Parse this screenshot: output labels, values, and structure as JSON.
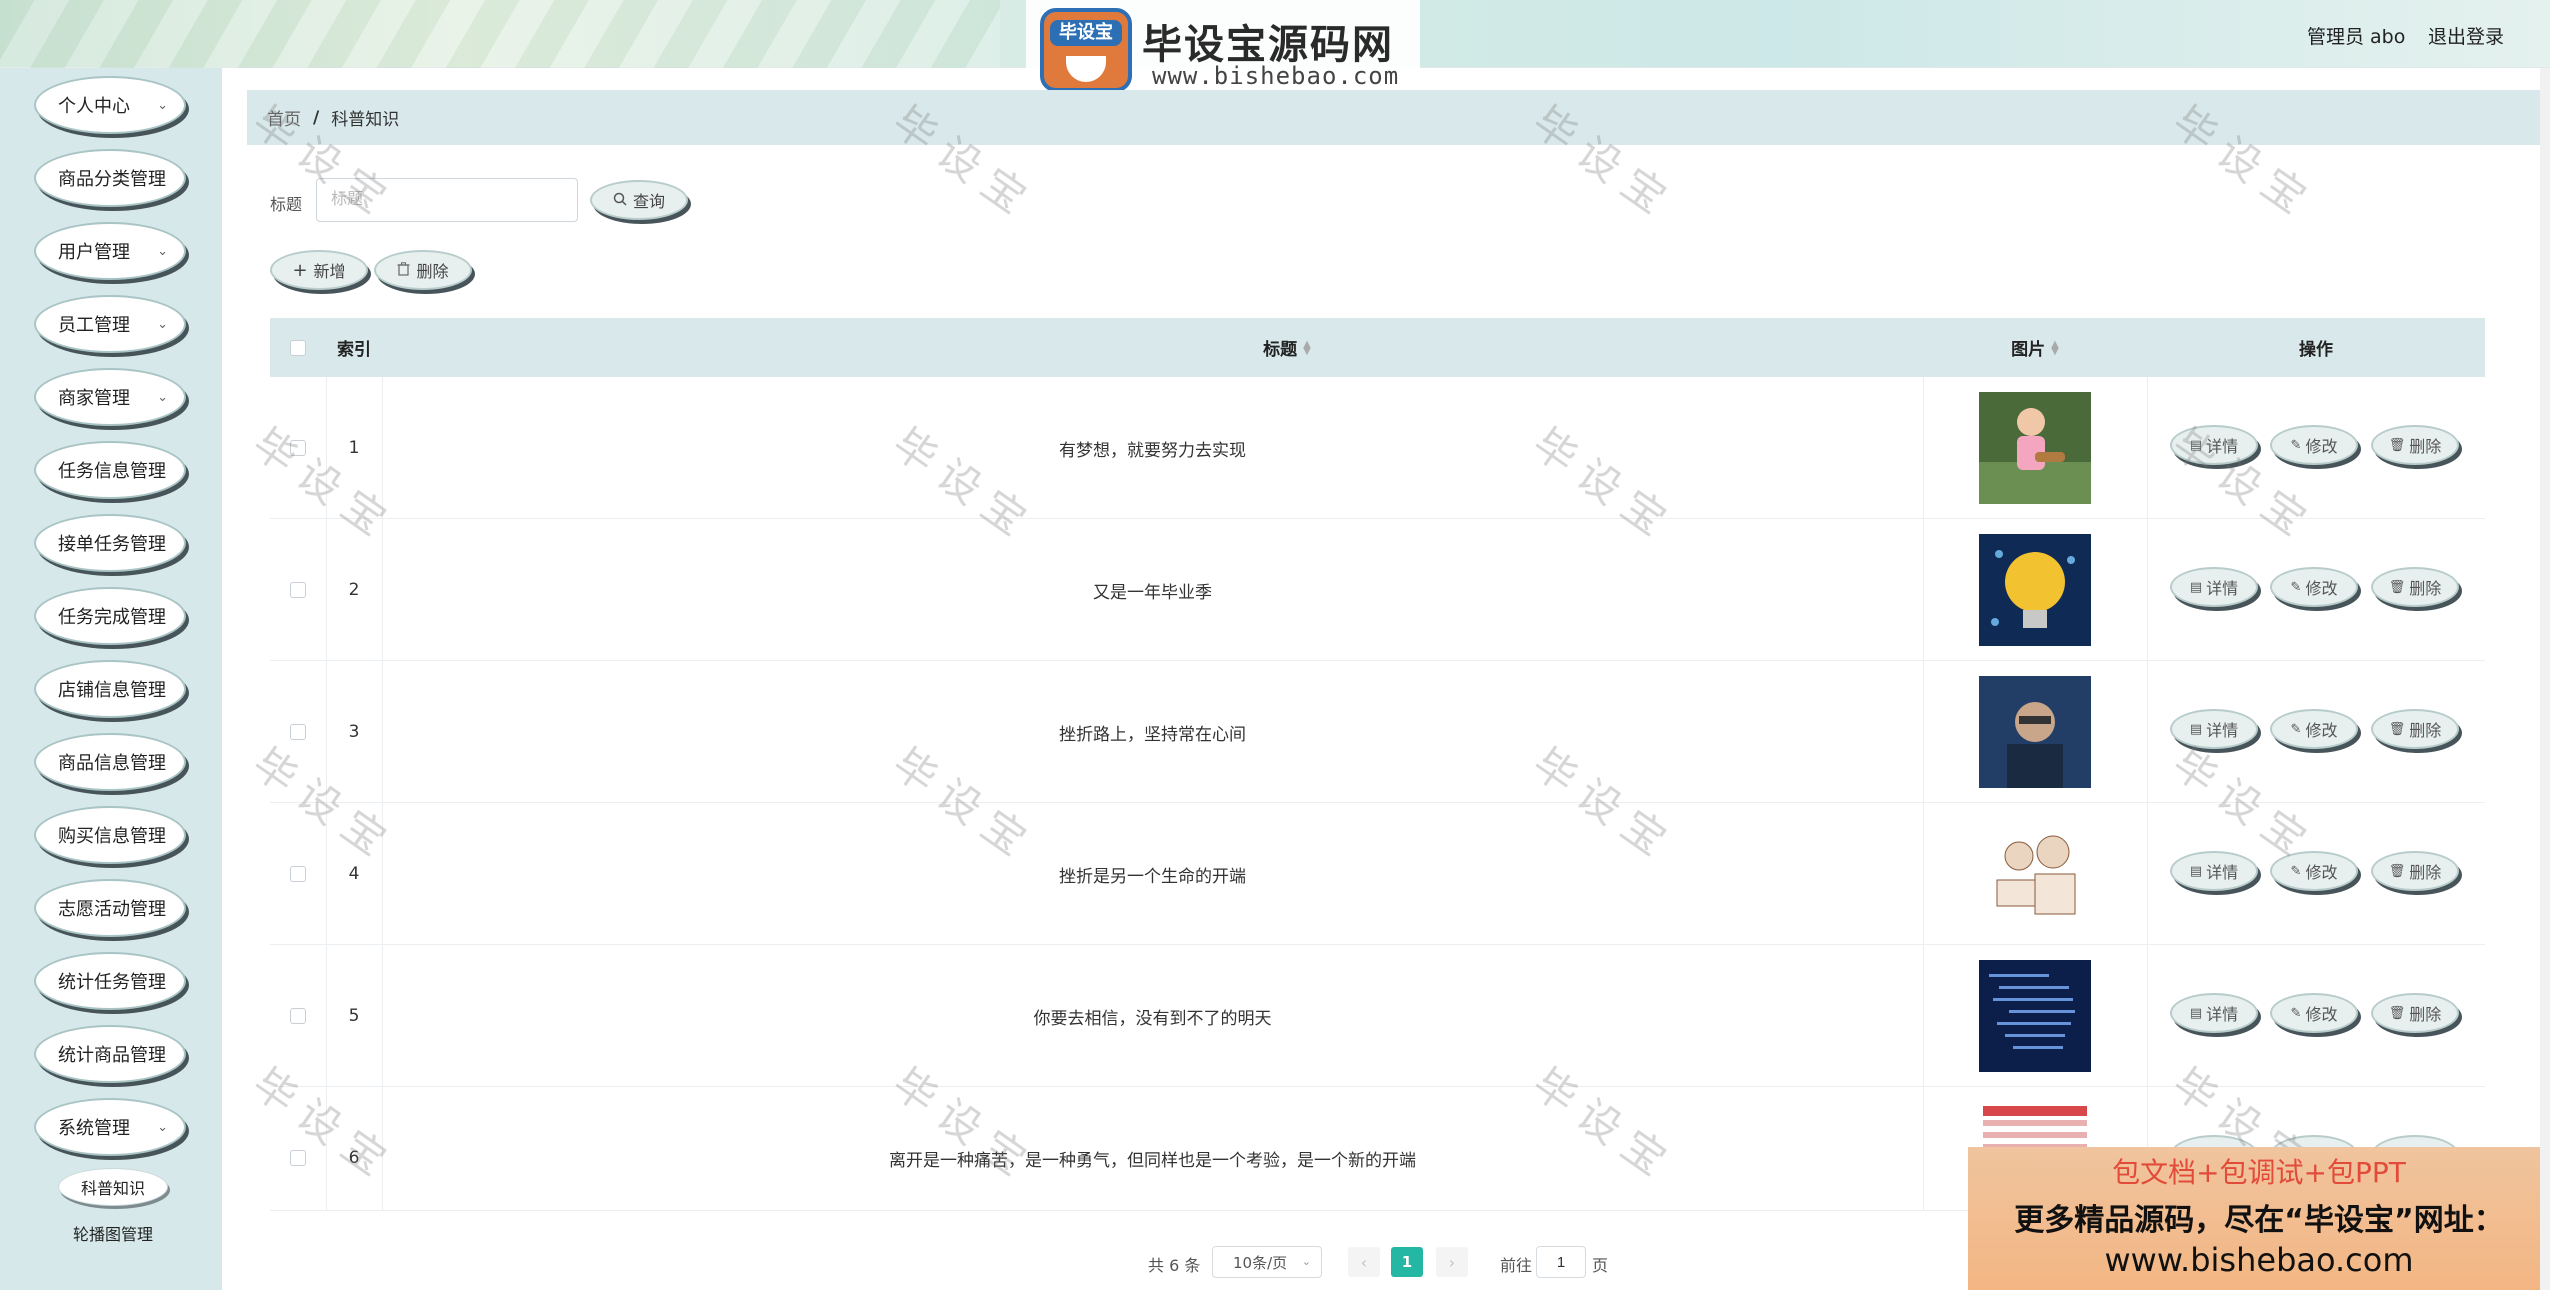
{
  "header": {
    "logo_badge": "毕设宝",
    "logo_title": "毕设宝源码网",
    "logo_url": "www.bishebao.com",
    "admin_label": "管理员 abo",
    "logout_label": "退出登录"
  },
  "sidebar": {
    "items": [
      {
        "label": "个人中心",
        "has_arrow": true
      },
      {
        "label": "商品分类管理",
        "has_arrow": false
      },
      {
        "label": "用户管理",
        "has_arrow": true
      },
      {
        "label": "员工管理",
        "has_arrow": true
      },
      {
        "label": "商家管理",
        "has_arrow": true
      },
      {
        "label": "任务信息管理",
        "has_arrow": false
      },
      {
        "label": "接单任务管理",
        "has_arrow": false
      },
      {
        "label": "任务完成管理",
        "has_arrow": false
      },
      {
        "label": "店铺信息管理",
        "has_arrow": false
      },
      {
        "label": "商品信息管理",
        "has_arrow": false
      },
      {
        "label": "购买信息管理",
        "has_arrow": false
      },
      {
        "label": "志愿活动管理",
        "has_arrow": false
      },
      {
        "label": "统计任务管理",
        "has_arrow": false
      },
      {
        "label": "统计商品管理",
        "has_arrow": false
      },
      {
        "label": "系统管理",
        "has_arrow": true
      }
    ],
    "sub_items": [
      "科普知识",
      "轮播图管理"
    ],
    "arrow_glyph": "⌄"
  },
  "breadcrumb": {
    "home": "首页",
    "separator": "/",
    "current": "科普知识"
  },
  "search": {
    "label": "标题",
    "placeholder": "标题",
    "value": "",
    "button": "查询"
  },
  "toolbar": {
    "add": "新增",
    "delete": "删除"
  },
  "table": {
    "columns": {
      "index": "索引",
      "title": "标题",
      "image": "图片",
      "actions": "操作"
    },
    "rows": [
      {
        "index": "1",
        "title": "有梦想，就要努力去实现"
      },
      {
        "index": "2",
        "title": "又是一年毕业季"
      },
      {
        "index": "3",
        "title": "挫折路上，坚持常在心间"
      },
      {
        "index": "4",
        "title": "挫折是另一个生命的开端"
      },
      {
        "index": "5",
        "title": "你要去相信，没有到不了的明天"
      },
      {
        "index": "6",
        "title": "离开是一种痛苦，是一种勇气，但同样也是一个考验，是一个新的开端"
      }
    ],
    "actions": {
      "detail": "详情",
      "edit": "修改",
      "delete": "删除"
    }
  },
  "pagination": {
    "total": "共 6 条",
    "page_size": "10条/页",
    "current_page": "1",
    "goto_label": "前往",
    "goto_value": "1",
    "page_suffix": "页"
  },
  "watermark": "毕设宝",
  "promo": {
    "line1": "包文档+包调试+包PPT",
    "line2": "更多精品源码，尽在“毕设宝”网址：",
    "line3": "www.bishebao.com"
  },
  "colors": {
    "accent": "#23b7a4",
    "sidebar_bg": "#d6e8ea",
    "header_row_bg": "#d9e8ea",
    "promo_red": "#e24b3a"
  }
}
